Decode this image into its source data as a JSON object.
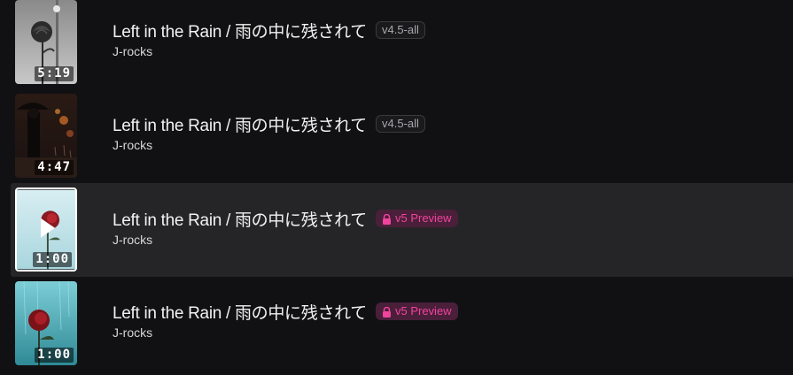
{
  "tracks": [
    {
      "title": "Left in the Rain / 雨の中に残されて",
      "artist": "J-rocks",
      "duration": "5:19",
      "badge": "v4.5-all",
      "badge_type": "plain",
      "thumb": "rose-street",
      "selected": false
    },
    {
      "title": "Left in the Rain / 雨の中に残されて",
      "artist": "J-rocks",
      "duration": "4:47",
      "badge": "v4.5-all",
      "badge_type": "plain",
      "thumb": "umbrella-rain",
      "selected": false
    },
    {
      "title": "Left in the Rain / 雨の中に残されて",
      "artist": "J-rocks",
      "duration": "1:00",
      "badge": "v5 Preview",
      "badge_type": "preview",
      "thumb": "red-rose-light",
      "selected": true
    },
    {
      "title": "Left in the Rain / 雨の中に残されて",
      "artist": "J-rocks",
      "duration": "1:00",
      "badge": "v5 Preview",
      "badge_type": "preview",
      "thumb": "red-rose-teal",
      "selected": false
    }
  ],
  "colors": {
    "background": "#111113",
    "selected_row": "#252528",
    "preview_badge_text": "#f0449d",
    "preview_badge_bg": "#4a1f3a"
  }
}
